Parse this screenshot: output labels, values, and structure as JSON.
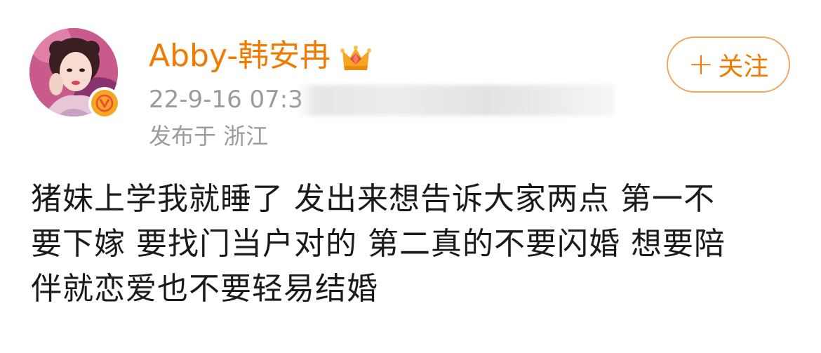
{
  "author": {
    "name": "Abby-韩安冉",
    "avatar_icon": "profile-photo",
    "badge_icon": "verified-v-icon",
    "crown_icon": "vip-crown-icon",
    "name_color": "#f07b00"
  },
  "meta": {
    "timestamp": "22-9-16 07:3",
    "location": "发布于 浙江"
  },
  "follow_button": {
    "plus": "+",
    "label": "关注"
  },
  "post": {
    "lines": [
      "猪妹上学我就睡了 发出来想告诉大家两点 第一不",
      "要下嫁 要找门当户对的 第二真的不要闪婚  想要陪",
      "伴就恋爱也不要轻易结婚"
    ]
  }
}
